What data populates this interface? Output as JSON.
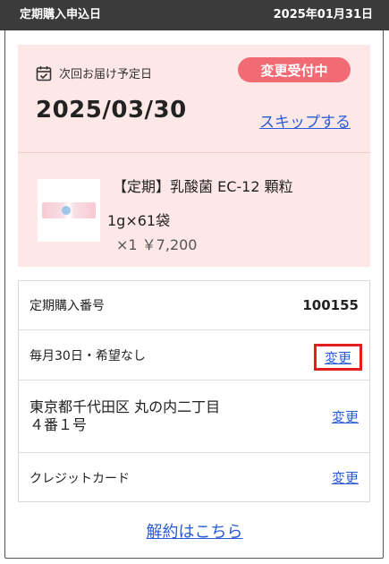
{
  "header": {
    "label": "定期購入申込日",
    "date": "2025年01月31日"
  },
  "delivery": {
    "label": "次回お届け予定日",
    "date": "2025/03/30",
    "badge": "変更受付中",
    "skip_label": "スキップする"
  },
  "product": {
    "name": "【定期】乳酸菌 EC-12 顆粒",
    "size": "1g×61袋",
    "qty_price": "×1 ￥7,200"
  },
  "info": {
    "order_label": "定期購入番号",
    "order_number": "100155",
    "schedule": "毎月30日・希望なし",
    "address_line1": "東京都千代田区 丸の内二丁目",
    "address_line2": "４番１号",
    "payment": "クレジットカード",
    "change_label": "変更"
  },
  "footer": {
    "cancel_label": "解約はこちら"
  },
  "colors": {
    "topbar": "#3b3b3b",
    "card_bg": "#fde7e7",
    "badge": "#f06b73",
    "link": "#2a5bd7",
    "highlight": "#e11d1d"
  }
}
